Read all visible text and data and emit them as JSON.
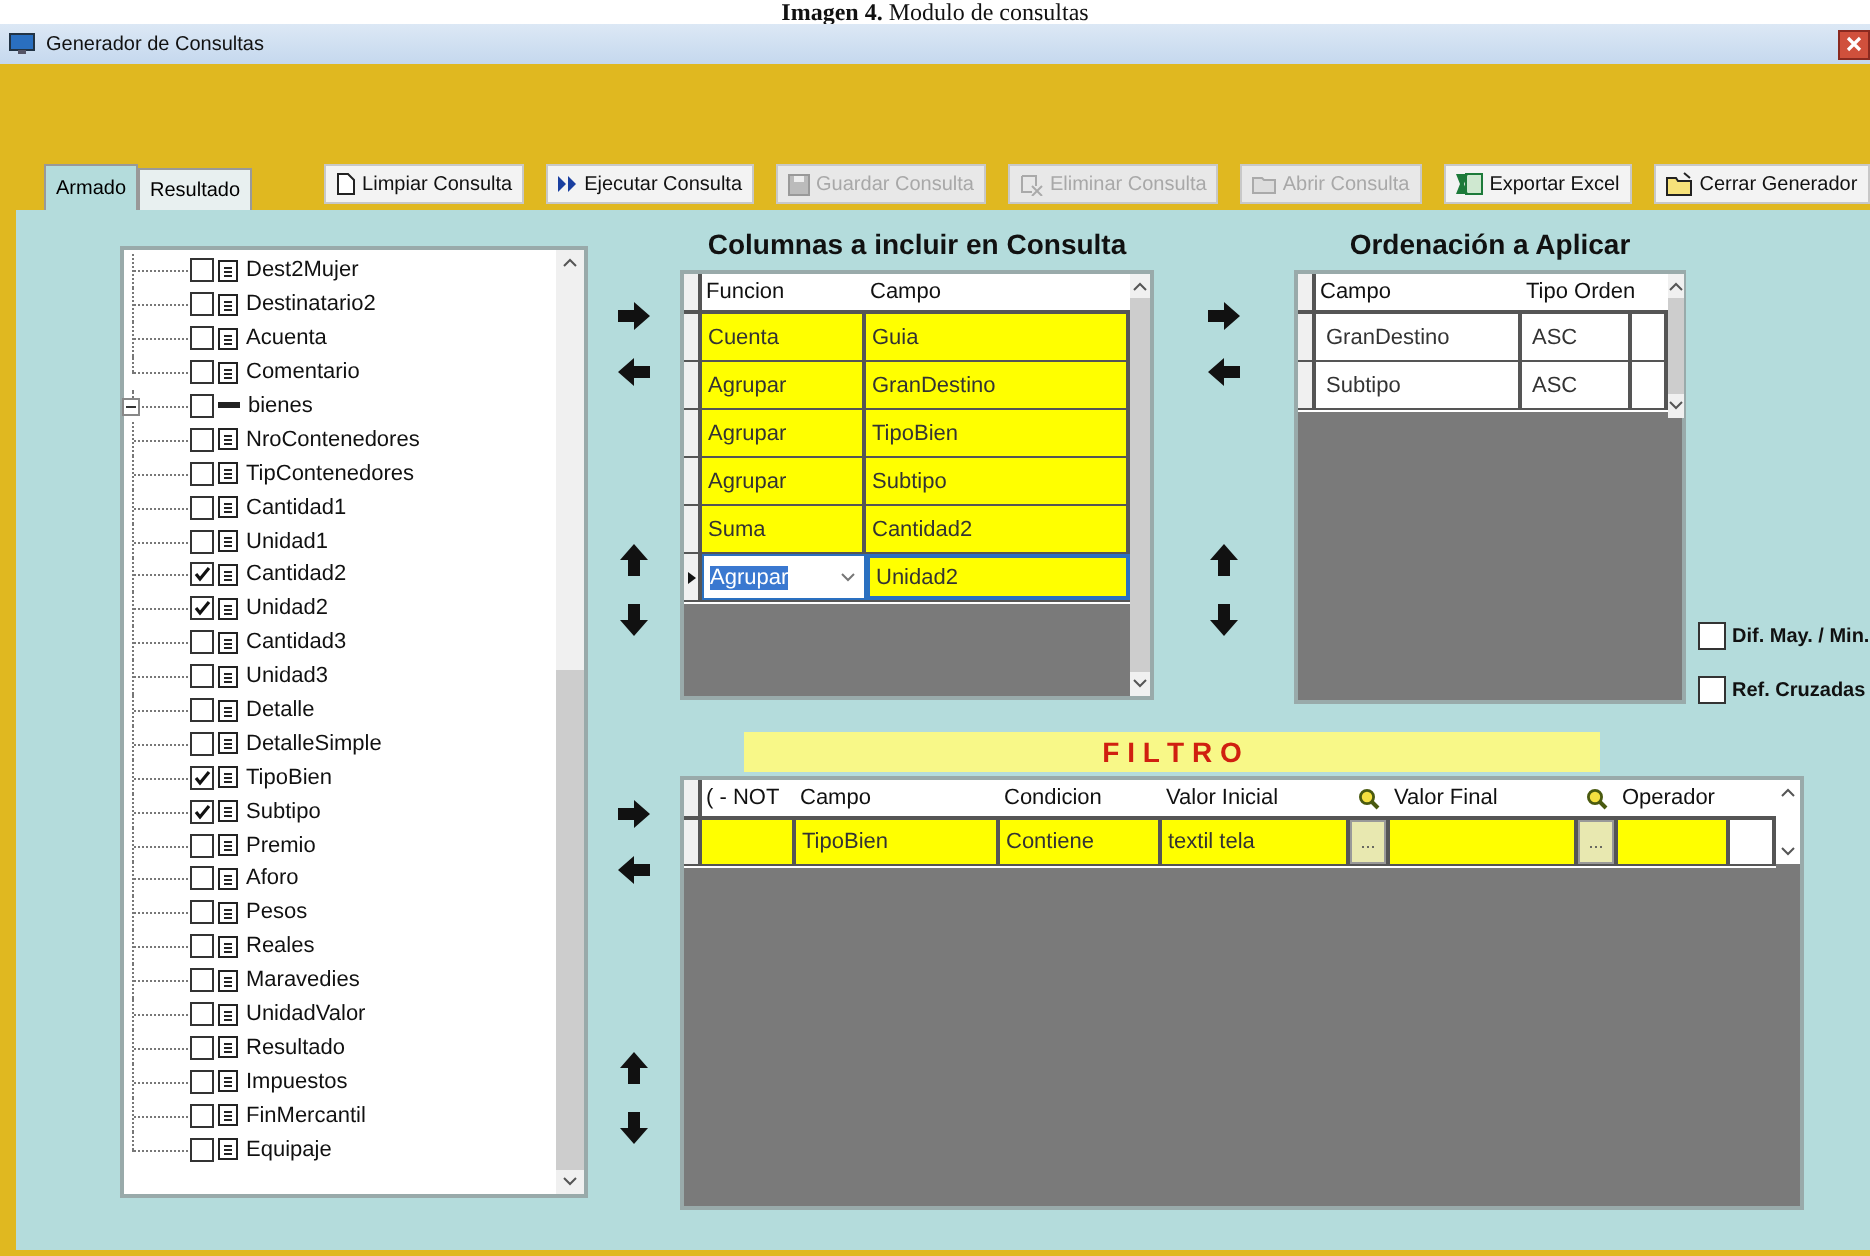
{
  "caption": "**Imagen 4.** Modulo de consultas",
  "window": {
    "title": "Generador de Consultas"
  },
  "tabs": [
    {
      "label": "Armado",
      "selected": true
    },
    {
      "label": "Resultado",
      "selected": false
    }
  ],
  "toolbar": [
    {
      "label": "Limpiar Consulta",
      "disabled": false
    },
    {
      "label": "Ejecutar Consulta",
      "disabled": false
    },
    {
      "label": "Guardar Consulta",
      "disabled": true
    },
    {
      "label": "Eliminar Consulta",
      "disabled": true
    },
    {
      "label": "Abrir Consulta",
      "disabled": true
    },
    {
      "label": "Exportar Excel",
      "disabled": false
    },
    {
      "label": "Cerrar Generador",
      "disabled": false
    }
  ],
  "tree": {
    "nodes": [
      {
        "children": [
          {
            "label": "Dest2Mujer",
            "checked": false
          },
          {
            "label": "Destinatario2",
            "checked": false
          },
          {
            "label": "Acuenta",
            "checked": false
          },
          {
            "label": "Comentario",
            "checked": false
          }
        ]
      },
      {
        "label": "bienes",
        "checked": false,
        "expanded": true,
        "children": [
          {
            "label": "NroContenedores",
            "checked": false
          },
          {
            "label": "TipContenedores",
            "checked": false
          },
          {
            "label": "Cantidad1",
            "checked": false
          },
          {
            "label": "Unidad1",
            "checked": false
          },
          {
            "label": "Cantidad2",
            "checked": true
          },
          {
            "label": "Unidad2",
            "checked": true
          },
          {
            "label": "Cantidad3",
            "checked": false
          },
          {
            "label": "Unidad3",
            "checked": false
          },
          {
            "label": "Detalle",
            "checked": false
          },
          {
            "label": "DetalleSimple",
            "checked": false
          },
          {
            "label": "TipoBien",
            "checked": true
          },
          {
            "label": "Subtipo",
            "checked": true
          },
          {
            "label": "Premio",
            "checked": false
          },
          {
            "label": "Aforo",
            "checked": false
          },
          {
            "label": "Pesos",
            "checked": false
          },
          {
            "label": "Reales",
            "checked": false
          },
          {
            "label": "Maravedies",
            "checked": false
          },
          {
            "label": "UnidadValor",
            "checked": false
          },
          {
            "label": "Resultado",
            "checked": false
          },
          {
            "label": "Impuestos",
            "checked": false
          },
          {
            "label": "FinMercantil",
            "checked": false
          },
          {
            "label": "Equipaje",
            "checked": false
          }
        ]
      }
    ]
  },
  "columns_grid": {
    "title": "Columnas a incluir en Consulta",
    "headers": [
      "Funcion",
      "Campo"
    ],
    "rows": [
      {
        "funcion": "Cuenta",
        "campo": "Guia",
        "selected": false
      },
      {
        "funcion": "Agrupar",
        "campo": "GranDestino",
        "selected": false
      },
      {
        "funcion": "Agrupar",
        "campo": "TipoBien",
        "selected": false
      },
      {
        "funcion": "Agrupar",
        "campo": "Subtipo",
        "selected": false
      },
      {
        "funcion": "Suma",
        "campo": "Cantidad2",
        "selected": false
      },
      {
        "funcion": "Agrupar",
        "campo": "Unidad2",
        "selected": true
      }
    ]
  },
  "order_grid": {
    "title": "Ordenación a Aplicar",
    "headers": [
      "Campo",
      "Tipo Orden"
    ],
    "rows": [
      {
        "campo": "GranDestino",
        "tipo": "ASC"
      },
      {
        "campo": "Subtipo",
        "tipo": "ASC"
      }
    ]
  },
  "options": [
    {
      "label": "Dif. May. / Min.",
      "checked": false
    },
    {
      "label": "Ref. Cruzadas",
      "checked": false
    }
  ],
  "filter": {
    "title": "F I L T R O",
    "columns": [
      {
        "kind": "text",
        "label": "( - NOT"
      },
      {
        "kind": "text",
        "label": "Campo"
      },
      {
        "kind": "text",
        "label": "Condicion"
      },
      {
        "kind": "text",
        "label": "Valor Inicial"
      },
      {
        "kind": "lookup"
      },
      {
        "kind": "text",
        "label": "Valor Final"
      },
      {
        "kind": "lookup"
      },
      {
        "kind": "text",
        "label": "Operador"
      }
    ],
    "rows": [
      {
        "cells": [
          {
            "kind": "text"
          },
          {
            "kind": "text",
            "text": "TipoBien"
          },
          {
            "kind": "text",
            "text": "Contiene"
          },
          {
            "kind": "text",
            "text": "textil tela"
          },
          {
            "kind": "button",
            "text": "..."
          },
          {
            "kind": "text"
          },
          {
            "kind": "button",
            "text": "..."
          },
          {
            "kind": "text"
          }
        ]
      }
    ]
  }
}
